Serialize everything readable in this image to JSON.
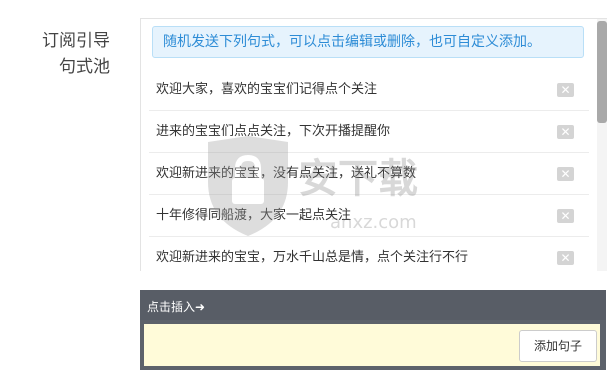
{
  "label": {
    "line1": "订阅引导",
    "line2": "句式池"
  },
  "notice": "随机发送下列句式，可以点击编辑或删除，也可自定义添加。",
  "phrases": [
    {
      "text": "欢迎大家，喜欢的宝宝们记得点个关注",
      "delete": "✕"
    },
    {
      "text": "进来的宝宝们点点关注，下次开播提醒你",
      "delete": "✕"
    },
    {
      "text": "欢迎新进来的宝宝，没有点关注，送礼不算数",
      "delete": "✕"
    },
    {
      "text": "十年修得同船渡，大家一起点关注",
      "delete": "✕"
    },
    {
      "text": "欢迎新进来的宝宝，万水千山总是情，点个关注行不行",
      "delete": "✕"
    }
  ],
  "insert": {
    "label": "点击插入➜"
  },
  "input": {
    "value": "",
    "button": "添加句子"
  },
  "watermark": {
    "text": "安下载",
    "subtext": "anxz.com",
    "icon": "shield-lock-icon"
  },
  "colors": {
    "notice_text": "#2d8cd6",
    "notice_bg": "#e6f3fd",
    "bar_bg": "#585d66",
    "input_bg": "#fffbd9"
  }
}
